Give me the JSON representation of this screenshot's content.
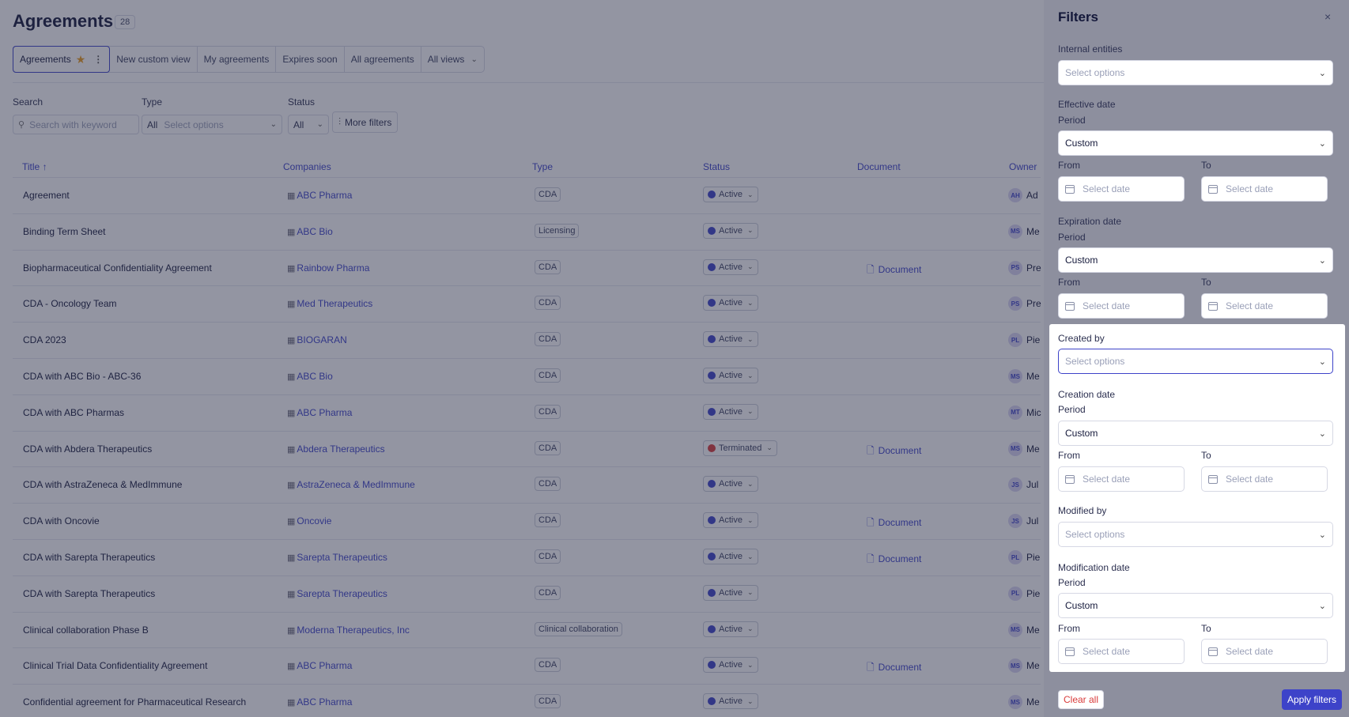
{
  "page": {
    "title": "Agreements",
    "count": "28"
  },
  "views": [
    {
      "label": "Agreements"
    },
    {
      "label": "New custom view"
    },
    {
      "label": "My agreements"
    },
    {
      "label": "Expires soon"
    },
    {
      "label": "All agreements"
    },
    {
      "label": "All views"
    }
  ],
  "filters": {
    "search_label": "Search",
    "search_placeholder": "Search with keyword",
    "type_label": "Type",
    "type_all": "All",
    "type_placeholder": "Select options",
    "status_label": "Status",
    "status_all": "All",
    "more_filters": "More filters"
  },
  "table": {
    "columns": [
      "Title",
      "Companies",
      "Type",
      "Status",
      "Document",
      "Owner"
    ],
    "rows": [
      {
        "title": "Agreement",
        "company": "ABC Pharma",
        "type": "CDA",
        "status": "Active",
        "document": "",
        "owner_initials": "AH",
        "owner": "Ad"
      },
      {
        "title": "Binding Term Sheet",
        "company": "ABC Bio",
        "type": "Licensing",
        "status": "Active",
        "document": "",
        "owner_initials": "MS",
        "owner": "Me"
      },
      {
        "title": "Biopharmaceutical Confidentiality Agreement",
        "company": "Rainbow Pharma",
        "type": "CDA",
        "status": "Active",
        "document": "Document",
        "owner_initials": "PS",
        "owner": "Pre"
      },
      {
        "title": "CDA - Oncology Team",
        "company": "Med Therapeutics",
        "type": "CDA",
        "status": "Active",
        "document": "",
        "owner_initials": "PS",
        "owner": "Pre"
      },
      {
        "title": "CDA 2023",
        "company": "BIOGARAN",
        "type": "CDA",
        "status": "Active",
        "document": "",
        "owner_initials": "PL",
        "owner": "Pie"
      },
      {
        "title": "CDA with ABC Bio - ABC-36",
        "company": "ABC Bio",
        "type": "CDA",
        "status": "Active",
        "document": "",
        "owner_initials": "MS",
        "owner": "Me"
      },
      {
        "title": "CDA with ABC Pharmas",
        "company": "ABC Pharma",
        "type": "CDA",
        "status": "Active",
        "document": "",
        "owner_initials": "MT",
        "owner": "Mic"
      },
      {
        "title": "CDA with Abdera Therapeutics",
        "company": "Abdera Therapeutics",
        "type": "CDA",
        "status": "Terminated",
        "document": "Document",
        "owner_initials": "MS",
        "owner": "Me"
      },
      {
        "title": "CDA with AstraZeneca & MedImmune",
        "company": "AstraZeneca & MedImmune",
        "type": "CDA",
        "status": "Active",
        "document": "",
        "owner_initials": "JS",
        "owner": "Jul"
      },
      {
        "title": "CDA with Oncovie",
        "company": "Oncovie",
        "type": "CDA",
        "status": "Active",
        "document": "Document",
        "owner_initials": "JS",
        "owner": "Jul"
      },
      {
        "title": "CDA with Sarepta Therapeutics",
        "company": "Sarepta Therapeutics",
        "type": "CDA",
        "status": "Active",
        "document": "Document",
        "owner_initials": "PL",
        "owner": "Pie"
      },
      {
        "title": "CDA with Sarepta Therapeutics",
        "company": "Sarepta Therapeutics",
        "type": "CDA",
        "status": "Active",
        "document": "",
        "owner_initials": "PL",
        "owner": "Pie"
      },
      {
        "title": "Clinical collaboration Phase B",
        "company": "Moderna Therapeutics, Inc",
        "type": "Clinical collaboration",
        "status": "Active",
        "document": "",
        "owner_initials": "MS",
        "owner": "Me"
      },
      {
        "title": "Clinical Trial Data Confidentiality Agreement",
        "company": "ABC Pharma",
        "type": "CDA",
        "status": "Active",
        "document": "Document",
        "owner_initials": "MS",
        "owner": "Me"
      },
      {
        "title": "Confidential agreement for Pharmaceutical Research",
        "company": "ABC Pharma",
        "type": "CDA",
        "status": "Active",
        "document": "",
        "owner_initials": "MS",
        "owner": "Me"
      }
    ]
  },
  "panel": {
    "title": "Filters",
    "close": "×",
    "internal_entities_label": "Internal entities",
    "select_options": "Select options",
    "select_date": "Select date",
    "period_label": "Period",
    "custom": "Custom",
    "from_label": "From",
    "to_label": "To",
    "effective_date_label": "Effective date",
    "expiration_date_label": "Expiration date",
    "created_by_label": "Created by",
    "creation_date_label": "Creation date",
    "modified_by_label": "Modified by",
    "modification_date_label": "Modification date",
    "clear_all": "Clear all",
    "apply": "Apply filters"
  },
  "colors": {
    "accent": "#3d43c9",
    "terminated": "#d93a3a",
    "star": "#e89a1c"
  }
}
